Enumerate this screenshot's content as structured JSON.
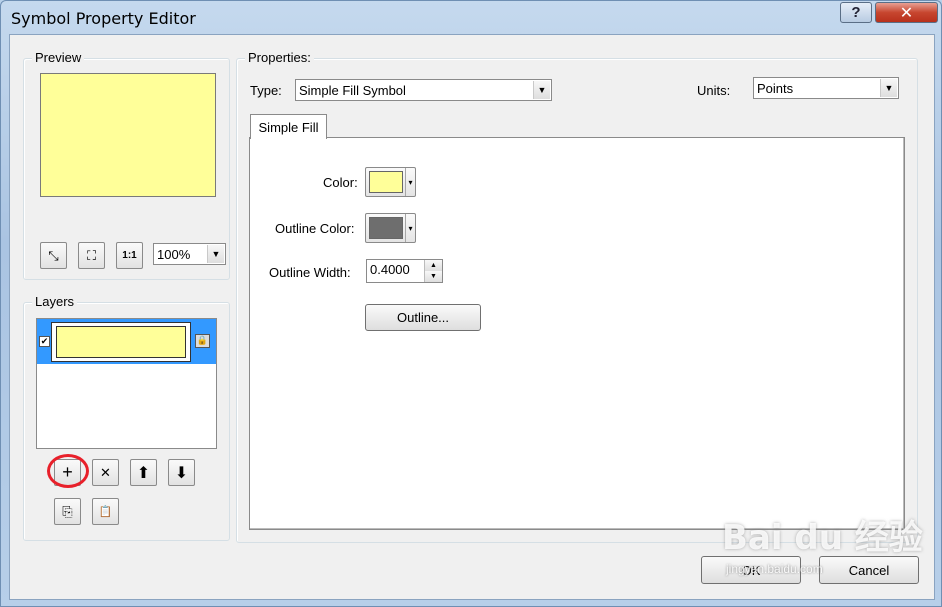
{
  "window": {
    "title": "Symbol Property Editor",
    "help_label": "?",
    "close_label": "✕"
  },
  "preview": {
    "legend": "Preview",
    "fill_color": "#ffff99",
    "zoom_value": "100%",
    "tools": [
      {
        "icon": "fit-to-window-icon",
        "glyph": "⤡"
      },
      {
        "icon": "zoom-extent-icon",
        "glyph": "⛶"
      },
      {
        "icon": "actual-size-icon",
        "glyph": "1:1"
      }
    ]
  },
  "layers": {
    "legend": "Layers",
    "items": [
      {
        "checked": true,
        "fill_color": "#ffff99"
      }
    ],
    "buttons": [
      {
        "name": "add-layer-button",
        "icon": "plus-icon",
        "glyph": "+"
      },
      {
        "name": "remove-layer-button",
        "icon": "x-icon",
        "glyph": "✕"
      },
      {
        "name": "move-up-button",
        "icon": "arrow-up-icon",
        "glyph": "⬆"
      },
      {
        "name": "move-down-button",
        "icon": "arrow-down-icon",
        "glyph": "⬇"
      },
      {
        "name": "copy-layer-button",
        "icon": "copy-icon",
        "glyph": "⎘"
      },
      {
        "name": "paste-layer-button",
        "icon": "paste-icon",
        "glyph": "📋"
      }
    ]
  },
  "properties": {
    "legend": "Properties:",
    "type_label": "Type:",
    "type_value": "Simple Fill Symbol",
    "units_label": "Units:",
    "units_value": "Points",
    "tab_label": "Simple Fill",
    "color_label": "Color:",
    "color_value": "#ffff99",
    "outline_color_label": "Outline Color:",
    "outline_color_value": "#6e6e6e",
    "outline_width_label": "Outline Width:",
    "outline_width_value": "0.4000",
    "outline_button": "Outline..."
  },
  "footer": {
    "ok_label": "OK",
    "cancel_label": "Cancel"
  },
  "watermark": {
    "brand": "Bai du 经验",
    "url": "jingyan.baidu.com"
  }
}
